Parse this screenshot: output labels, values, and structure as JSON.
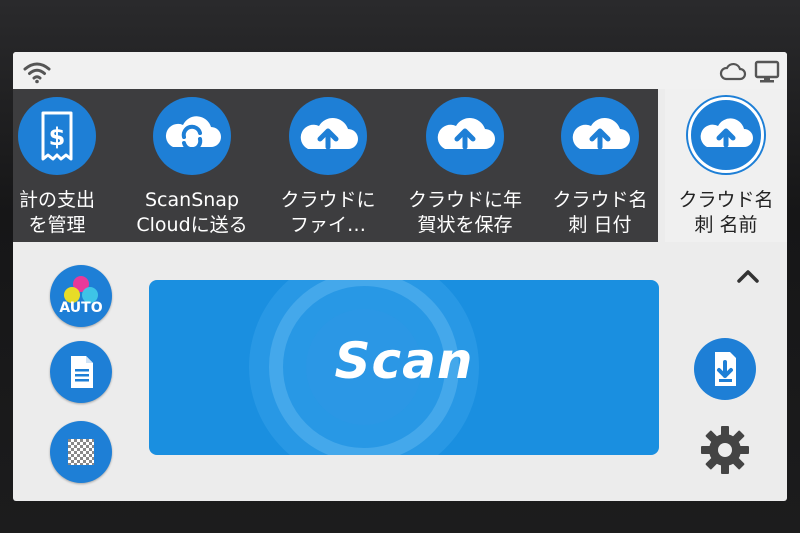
{
  "profiles": [
    {
      "label": "計の支出\nを管理",
      "icon": "receipt-icon"
    },
    {
      "label": "ScanSnap\nCloudに送る",
      "icon": "scansnap-cloud-icon"
    },
    {
      "label": "クラウドに\nファイ…",
      "icon": "cloud-upload-icon"
    },
    {
      "label": "クラウドに年\n賀状を保存",
      "icon": "cloud-upload-icon"
    },
    {
      "label": "クラウド名\n刺 日付",
      "icon": "cloud-upload-icon"
    }
  ],
  "selected_profile": {
    "label": "クラウド名\n刺 名前",
    "icon": "cloud-upload-icon"
  },
  "options": {
    "color_mode": "AUTO"
  },
  "scan_button": {
    "label": "Scan"
  },
  "colors": {
    "accent": "#1e7fd6",
    "scan": "#1a8fe0",
    "strip": "#3d3d3f",
    "background": "#ececec"
  }
}
